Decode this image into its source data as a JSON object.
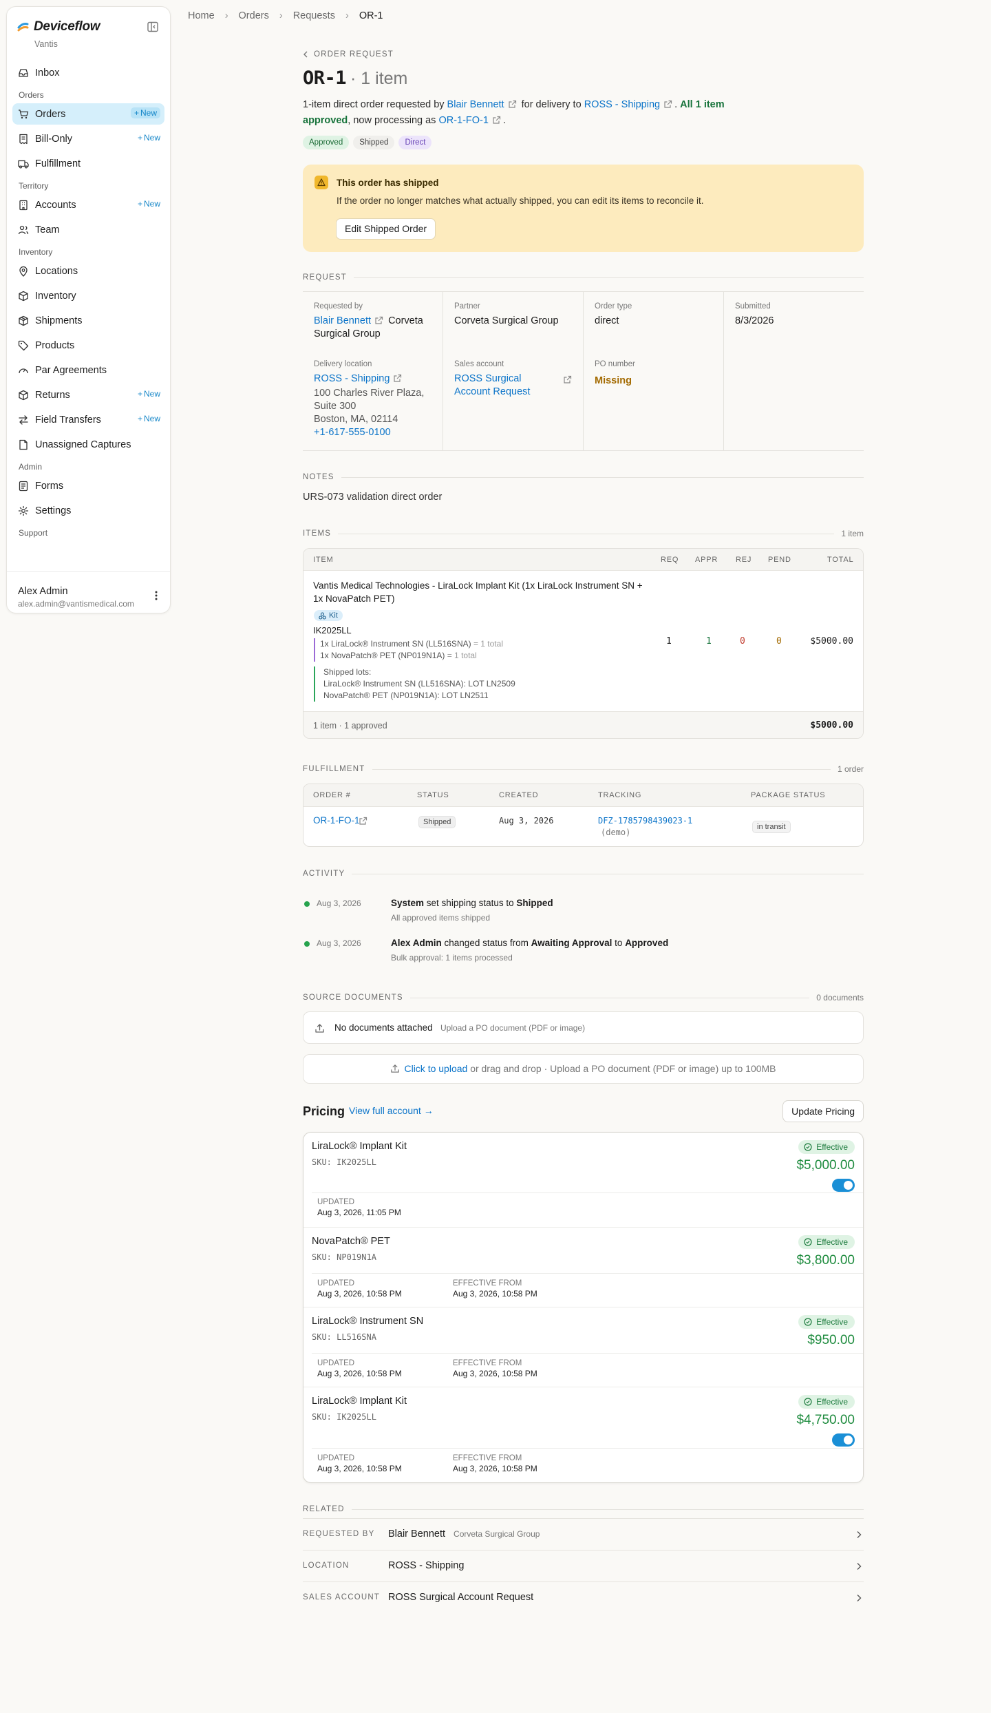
{
  "app": {
    "name": "Deviceflow",
    "org": "Vantis"
  },
  "sidebar": {
    "inbox": "Inbox",
    "sections": {
      "orders": "Orders",
      "territory": "Territory",
      "inventory": "Inventory",
      "admin": "Admin",
      "support": "Support"
    },
    "items": {
      "orders": "Orders",
      "bill_only": "Bill-Only",
      "fulfillment": "Fulfillment",
      "accounts": "Accounts",
      "team": "Team",
      "locations": "Locations",
      "inventory": "Inventory",
      "shipments": "Shipments",
      "products": "Products",
      "par_agreements": "Par Agreements",
      "returns": "Returns",
      "field_transfers": "Field Transfers",
      "unassigned_captures": "Unassigned Captures",
      "forms": "Forms",
      "settings": "Settings"
    },
    "new_badge": "New",
    "user": {
      "name": "Alex Admin",
      "email": "alex.admin@vantismedical.com"
    }
  },
  "breadcrumb": [
    "Home",
    "Orders",
    "Requests",
    "OR-1"
  ],
  "header": {
    "back_label": "ORDER REQUEST",
    "order_id": "OR-1",
    "item_count": "· 1 item",
    "intro": {
      "p1": "1-item direct order requested by",
      "requester": "Blair Bennett",
      "p2": "for delivery to",
      "location": "ROSS - Shipping",
      "approved_strong": "All 1 item approved",
      "p3": ", now processing as",
      "fulfillment_id": "OR-1-FO-1"
    },
    "tags": [
      "Approved",
      "Shipped",
      "Direct"
    ]
  },
  "banner": {
    "title": "This order has shipped",
    "desc": "If the order no longer matches what actually shipped, you can edit its items to reconcile it.",
    "button": "Edit Shipped Order"
  },
  "request": {
    "section_label": "REQUEST",
    "requested_by_label": "Requested by",
    "requested_by": "Blair Bennett",
    "requested_by_org": "Corveta Surgical Group",
    "partner_label": "Partner",
    "partner": "Corveta Surgical Group",
    "order_type_label": "Order type",
    "order_type": "direct",
    "submitted_label": "Submitted",
    "submitted": "8/3/2026",
    "delivery_label": "Delivery location",
    "delivery_name": "ROSS - Shipping",
    "address1": "100 Charles River Plaza,",
    "address2": "Suite 300",
    "address3": "Boston, MA, 02114",
    "phone": "+1-617-555-0100",
    "sales_account_label": "Sales account",
    "sales_account_l1": "ROSS Surgical",
    "sales_account_l2": "Account Request",
    "po_label": "PO number",
    "po_value": "Missing"
  },
  "notes": {
    "label": "NOTES",
    "text": "URS-073 validation direct order"
  },
  "items": {
    "label": "ITEMS",
    "count": "1 item",
    "columns": [
      "ITEM",
      "REQ",
      "APPR",
      "REJ",
      "PEND",
      "TOTAL"
    ],
    "row": {
      "name_l1": "Vantis Medical Technologies - LiraLock Implant Kit (1x LiraLock Instrument SN +",
      "name_l2": "1x NovaPatch PET)",
      "kit_badge": "Kit",
      "sku": "IK2025LL",
      "comp1": "1x LiraLock® Instrument SN (LL516SNA)",
      "comp1_total": "= 1 total",
      "comp2": "1x NovaPatch® PET (NP019N1A)",
      "comp2_total": "= 1 total",
      "lots_label": "Shipped lots:",
      "lot1": "LiraLock® Instrument SN (LL516SNA): LOT LN2509",
      "lot2": "NovaPatch® PET (NP019N1A): LOT LN2511",
      "req": "1",
      "appr": "1",
      "rej": "0",
      "pend": "0",
      "total": "$5000.00"
    },
    "footer_summary": "1 item · 1 approved",
    "footer_total": "$5000.00"
  },
  "fulfillment": {
    "label": "FULFILLMENT",
    "count": "1 order",
    "columns": [
      "ORDER #",
      "STATUS",
      "CREATED",
      "TRACKING",
      "PACKAGE STATUS"
    ],
    "row": {
      "order": "OR-1-FO-1",
      "status": "Shipped",
      "created": "Aug 3, 2026",
      "tracking": "DFZ-1785798439023-1",
      "tracking_note": "(demo)",
      "package_status": "in transit"
    }
  },
  "activity": {
    "label": "ACTIVITY",
    "entries": [
      {
        "date": "Aug 3, 2026",
        "actor": "System",
        "verb": "set shipping status to",
        "value": "Shipped",
        "sub": "All approved items shipped"
      },
      {
        "date": "Aug 3, 2026",
        "actor": "Alex Admin",
        "verb": "changed status from",
        "from": "Awaiting Approval",
        "to_word": "to",
        "value": "Approved",
        "sub": "Bulk approval: 1 items processed"
      }
    ]
  },
  "source_docs": {
    "label": "SOURCE DOCUMENTS",
    "count": "0 documents",
    "empty": "No documents attached",
    "empty_hint": "Upload a PO document (PDF or image)",
    "upload_link": "Click to upload",
    "upload_rest": "or drag and drop · Upload a PO document (PDF or image) up to 100MB"
  },
  "pricing": {
    "title": "Pricing",
    "view_link": "View full account →",
    "update_button": "Update Pricing",
    "effective": "Effective",
    "updated_label": "UPDATED",
    "effective_from_label": "EFFECTIVE FROM",
    "items": [
      {
        "name": "LiraLock® Implant Kit",
        "sku": "SKU: IK2025LL",
        "price": "$5,000.00",
        "updated": "Aug 3, 2026, 11:05 PM",
        "toggle": true
      },
      {
        "name": "NovaPatch® PET",
        "sku": "SKU: NP019N1A",
        "price": "$3,800.00",
        "updated": "Aug 3, 2026, 10:58 PM",
        "effective_from": "Aug 3, 2026, 10:58 PM"
      },
      {
        "name": "LiraLock® Instrument SN",
        "sku": "SKU: LL516SNA",
        "price": "$950.00",
        "updated": "Aug 3, 2026, 10:58 PM",
        "effective_from": "Aug 3, 2026, 10:58 PM"
      },
      {
        "name": "LiraLock® Implant Kit",
        "sku": "SKU: IK2025LL",
        "price": "$4,750.00",
        "updated": "Aug 3, 2026, 10:58 PM",
        "effective_from": "Aug 3, 2026, 10:58 PM",
        "toggle": true
      }
    ]
  },
  "related": {
    "label": "RELATED",
    "rows": [
      {
        "label": "REQUESTED BY",
        "value": "Blair Bennett",
        "sub": "Corveta Surgical Group"
      },
      {
        "label": "LOCATION",
        "value": "ROSS - Shipping"
      },
      {
        "label": "SALES ACCOUNT",
        "value": "ROSS Surgical Account Request"
      }
    ]
  },
  "colors": {
    "accent": "#0b74c9",
    "active_nav": "#d5effb",
    "banner": "#fdebbe",
    "success": "#1f8c3f",
    "warning": "#a36a00"
  }
}
